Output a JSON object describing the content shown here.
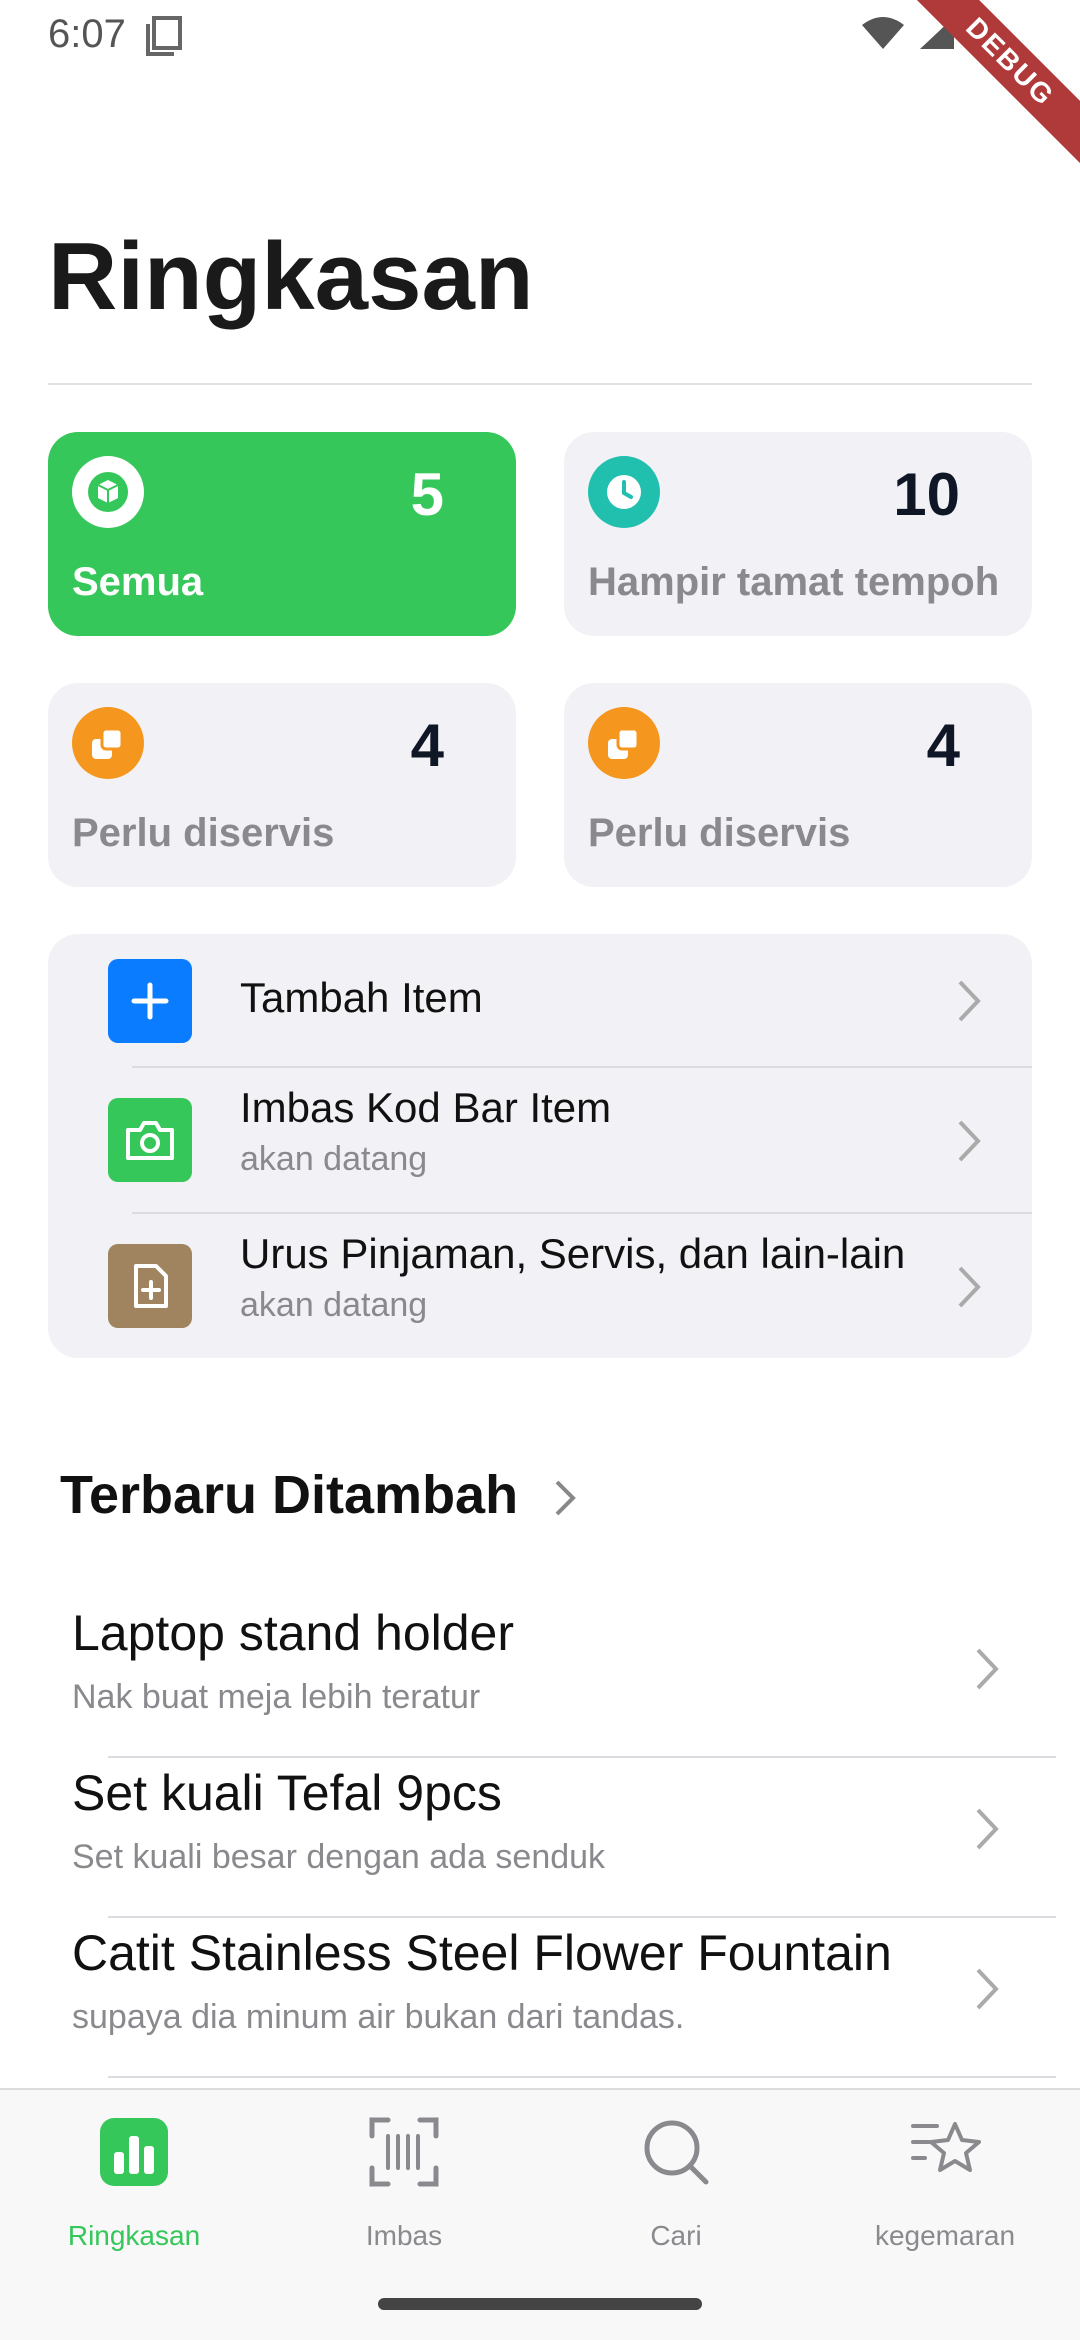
{
  "status_bar": {
    "time": "6:07",
    "debug_label": "DEBUG"
  },
  "title": "Ringkasan",
  "cards": [
    {
      "label": "Semua",
      "count": "5",
      "icon": "box-icon"
    },
    {
      "label": "Hampir tamat tempoh",
      "count": "10",
      "icon": "clock-icon"
    },
    {
      "label": "Perlu diservis",
      "count": "4",
      "icon": "layers-icon"
    },
    {
      "label": "Perlu diservis",
      "count": "4",
      "icon": "layers-icon"
    }
  ],
  "actions": [
    {
      "title": "Tambah Item",
      "subtitle": ""
    },
    {
      "title": "Imbas Kod Bar Item",
      "subtitle": "akan datang"
    },
    {
      "title": "Urus Pinjaman, Servis, dan lain-lain",
      "subtitle": "akan datang"
    }
  ],
  "recent": {
    "title": "Terbaru Ditambah",
    "items": [
      {
        "name": "Laptop stand holder",
        "desc": "Nak buat meja lebih teratur"
      },
      {
        "name": "Set kuali Tefal 9pcs",
        "desc": "Set kuali besar dengan ada senduk"
      },
      {
        "name": "Catit Stainless Steel Flower Fountain",
        "desc": "supaya dia minum air bukan dari tandas."
      }
    ]
  },
  "nav": [
    {
      "label": "Ringkasan",
      "active": true
    },
    {
      "label": "Imbas",
      "active": false
    },
    {
      "label": "Cari",
      "active": false
    },
    {
      "label": "kegemaran",
      "active": false
    }
  ],
  "colors": {
    "green": "#35c759",
    "blue": "#0a7cff",
    "teal": "#20bfae",
    "orange": "#f5961e",
    "brown": "#a0845f"
  }
}
